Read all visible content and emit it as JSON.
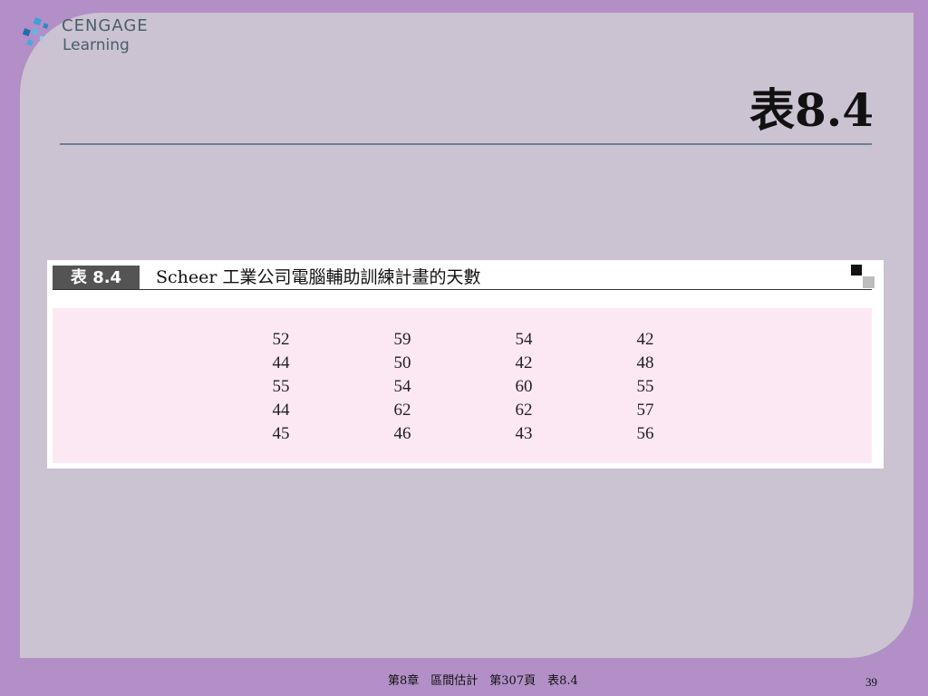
{
  "logo": {
    "line1": "CENGAGE",
    "line2": "Learning",
    "mark": "cengage-logo-mark"
  },
  "slide_title": "表8.4",
  "table": {
    "badge": "表 8.4",
    "caption": "Scheer 工業公司電腦輔助訓練計畫的天數",
    "columns": [
      [
        "52",
        "44",
        "55",
        "44",
        "45"
      ],
      [
        "59",
        "50",
        "54",
        "62",
        "46"
      ],
      [
        "54",
        "42",
        "60",
        "62",
        "43"
      ],
      [
        "42",
        "48",
        "55",
        "57",
        "56"
      ]
    ]
  },
  "footer": {
    "text": "第8章　區間估計　第307頁　表8.4",
    "page": "39"
  },
  "colors": {
    "background": "#b28fc6",
    "slide": "#cbc3d1",
    "data_area": "#fce8f2",
    "badge": "#545454"
  }
}
